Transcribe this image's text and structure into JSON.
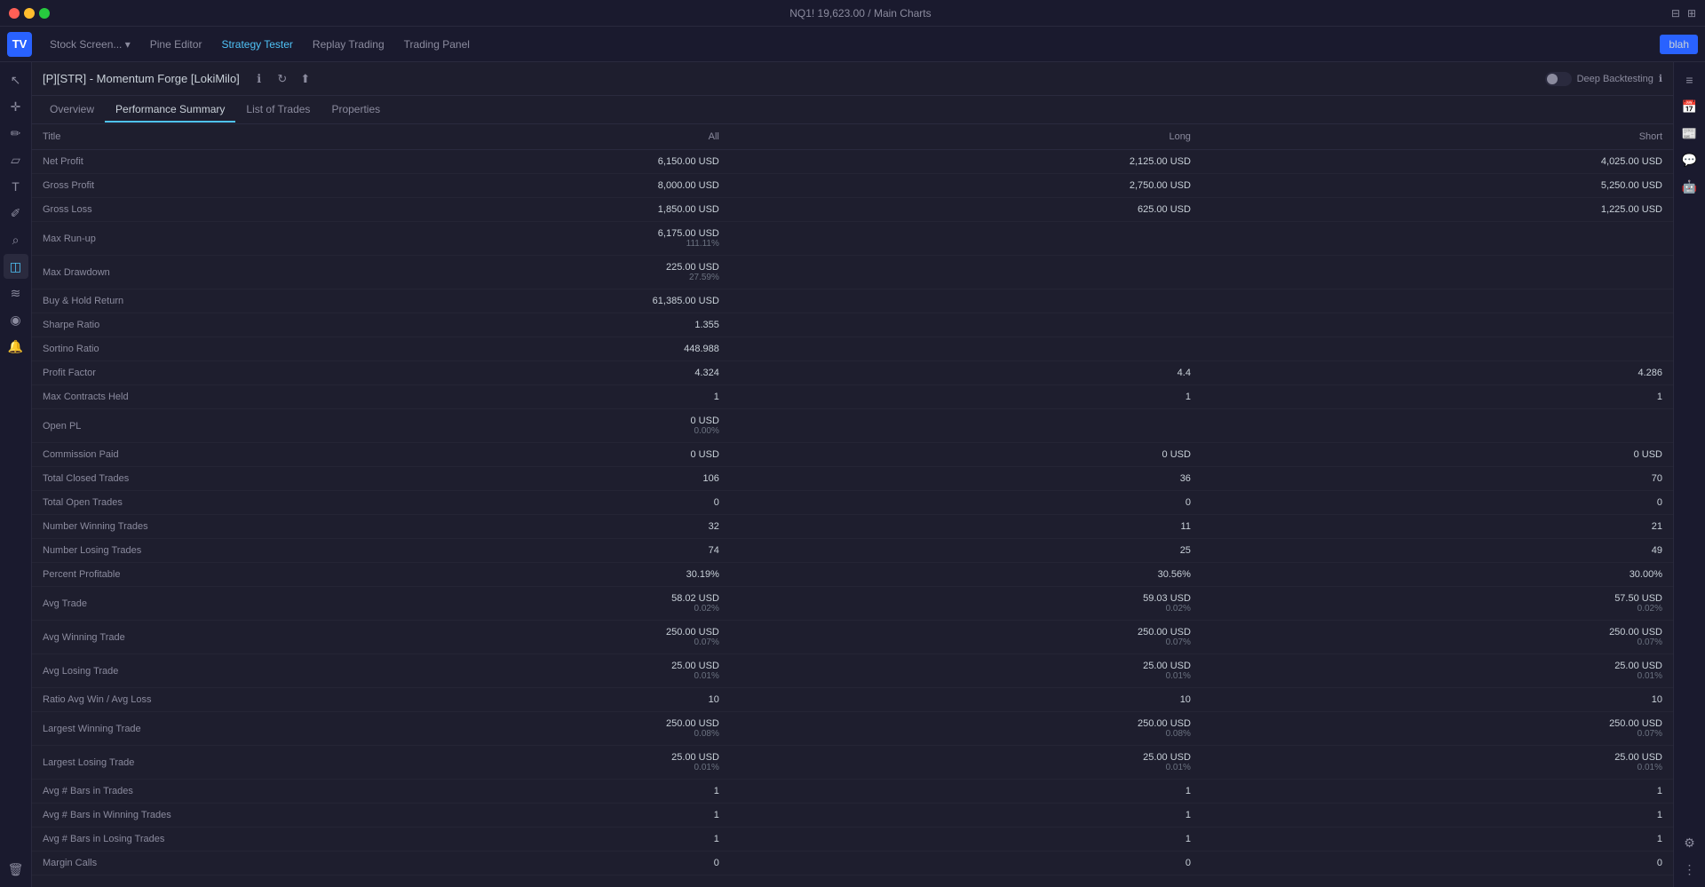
{
  "titlebar": {
    "title": "NQ1! 19,623.00 / Main Charts"
  },
  "topnav": {
    "logo": "TV",
    "items": [
      {
        "label": "Stock Screen...",
        "active": false,
        "dropdown": true
      },
      {
        "label": "Pine Editor",
        "active": false
      },
      {
        "label": "Strategy Tester",
        "active": true
      },
      {
        "label": "Replay Trading",
        "active": false
      },
      {
        "label": "Trading Panel",
        "active": false
      }
    ],
    "user_btn": "blah"
  },
  "left_sidebar_icons": [
    {
      "name": "cursor-icon",
      "symbol": "↖",
      "active": false
    },
    {
      "name": "crosshair-icon",
      "symbol": "+",
      "active": false
    },
    {
      "name": "pencil-icon",
      "symbol": "✏",
      "active": false
    },
    {
      "name": "shapes-icon",
      "symbol": "▱",
      "active": false
    },
    {
      "name": "text-icon",
      "symbol": "T",
      "active": false
    },
    {
      "name": "draw-icon",
      "symbol": "✐",
      "active": false
    },
    {
      "name": "search-icon",
      "symbol": "🔍",
      "active": false
    },
    {
      "name": "chart-icon",
      "symbol": "📊",
      "active": true
    },
    {
      "name": "indicator-icon",
      "symbol": "≋",
      "active": false
    },
    {
      "name": "eye-icon",
      "symbol": "👁",
      "active": false
    },
    {
      "name": "alert-icon",
      "symbol": "🔔",
      "active": false
    },
    {
      "name": "trash-icon",
      "symbol": "🗑",
      "active": false
    }
  ],
  "strategy_tester": {
    "script_name": "[P][STR] - Momentum Forge [LokiMilo]",
    "deep_backtesting_label": "Deep Backtesting"
  },
  "tabs": [
    {
      "label": "Overview",
      "active": false
    },
    {
      "label": "Performance Summary",
      "active": true
    },
    {
      "label": "List of Trades",
      "active": false
    },
    {
      "label": "Properties",
      "active": false
    }
  ],
  "table": {
    "headers": [
      {
        "label": "Title",
        "align": "left"
      },
      {
        "label": "All",
        "align": "right"
      },
      {
        "label": "Long",
        "align": "right"
      },
      {
        "label": "Short",
        "align": "right"
      }
    ],
    "rows": [
      {
        "title": "Net Profit",
        "all": "6,150.00 USD",
        "all2": "",
        "long": "2,125.00 USD",
        "long2": "",
        "short": "4,025.00 USD",
        "short2": ""
      },
      {
        "title": "Gross Profit",
        "all": "8,000.00 USD",
        "all2": "",
        "long": "2,750.00 USD",
        "long2": "",
        "short": "5,250.00 USD",
        "short2": ""
      },
      {
        "title": "Gross Loss",
        "all": "1,850.00 USD",
        "all2": "",
        "long": "625.00 USD",
        "long2": "",
        "short": "1,225.00 USD",
        "short2": ""
      },
      {
        "title": "Max Run-up",
        "all": "6,175.00 USD",
        "all2": "111.11%",
        "long": "",
        "long2": "",
        "short": "",
        "short2": ""
      },
      {
        "title": "Max Drawdown",
        "all": "225.00 USD",
        "all2": "27.59%",
        "long": "",
        "long2": "",
        "short": "",
        "short2": ""
      },
      {
        "title": "Buy & Hold Return",
        "all": "61,385.00 USD",
        "all2": "",
        "long": "",
        "long2": "",
        "short": "",
        "short2": ""
      },
      {
        "title": "Sharpe Ratio",
        "all": "1.355",
        "all2": "",
        "long": "",
        "long2": "",
        "short": "",
        "short2": ""
      },
      {
        "title": "Sortino Ratio",
        "all": "448.988",
        "all2": "",
        "long": "",
        "long2": "",
        "short": "",
        "short2": ""
      },
      {
        "title": "Profit Factor",
        "all": "4.324",
        "all2": "",
        "long": "4.4",
        "long2": "",
        "short": "4.286",
        "short2": ""
      },
      {
        "title": "Max Contracts Held",
        "all": "1",
        "all2": "",
        "long": "1",
        "long2": "",
        "short": "1",
        "short2": ""
      },
      {
        "title": "Open PL",
        "all": "0 USD",
        "all2": "0.00%",
        "long": "",
        "long2": "",
        "short": "",
        "short2": ""
      },
      {
        "title": "Commission Paid",
        "all": "0 USD",
        "all2": "",
        "long": "0 USD",
        "long2": "",
        "short": "0 USD",
        "short2": ""
      },
      {
        "title": "Total Closed Trades",
        "all": "106",
        "all2": "",
        "long": "36",
        "long2": "",
        "short": "70",
        "short2": ""
      },
      {
        "title": "Total Open Trades",
        "all": "0",
        "all2": "",
        "long": "0",
        "long2": "",
        "short": "0",
        "short2": ""
      },
      {
        "title": "Number Winning Trades",
        "all": "32",
        "all2": "",
        "long": "11",
        "long2": "",
        "short": "21",
        "short2": ""
      },
      {
        "title": "Number Losing Trades",
        "all": "74",
        "all2": "",
        "long": "25",
        "long2": "",
        "short": "49",
        "short2": ""
      },
      {
        "title": "Percent Profitable",
        "all": "30.19%",
        "all2": "",
        "long": "30.56%",
        "long2": "",
        "short": "30.00%",
        "short2": ""
      },
      {
        "title": "Avg Trade",
        "all": "58.02 USD",
        "all2": "0.02%",
        "long": "59.03 USD",
        "long2": "0.02%",
        "short": "57.50 USD",
        "short2": "0.02%"
      },
      {
        "title": "Avg Winning Trade",
        "all": "250.00 USD",
        "all2": "0.07%",
        "long": "250.00 USD",
        "long2": "0.07%",
        "short": "250.00 USD",
        "short2": "0.07%"
      },
      {
        "title": "Avg Losing Trade",
        "all": "25.00 USD",
        "all2": "0.01%",
        "long": "25.00 USD",
        "long2": "0.01%",
        "short": "25.00 USD",
        "short2": "0.01%"
      },
      {
        "title": "Ratio Avg Win / Avg Loss",
        "all": "10",
        "all2": "",
        "long": "10",
        "long2": "",
        "short": "10",
        "short2": ""
      },
      {
        "title": "Largest Winning Trade",
        "all": "250.00 USD",
        "all2": "0.08%",
        "long": "250.00 USD",
        "long2": "0.08%",
        "short": "250.00 USD",
        "short2": "0.07%"
      },
      {
        "title": "Largest Losing Trade",
        "all": "25.00 USD",
        "all2": "0.01%",
        "long": "25.00 USD",
        "long2": "0.01%",
        "short": "25.00 USD",
        "short2": "0.01%"
      },
      {
        "title": "Avg # Bars in Trades",
        "all": "1",
        "all2": "",
        "long": "1",
        "long2": "",
        "short": "1",
        "short2": ""
      },
      {
        "title": "Avg # Bars in Winning Trades",
        "all": "1",
        "all2": "",
        "long": "1",
        "long2": "",
        "short": "1",
        "short2": ""
      },
      {
        "title": "Avg # Bars in Losing Trades",
        "all": "1",
        "all2": "",
        "long": "1",
        "long2": "",
        "short": "1",
        "short2": ""
      },
      {
        "title": "Margin Calls",
        "all": "0",
        "all2": "",
        "long": "0",
        "long2": "",
        "short": "0",
        "short2": ""
      }
    ]
  },
  "right_sidebar_icons": [
    {
      "name": "watchlist-icon",
      "symbol": "≡"
    },
    {
      "name": "calendar-icon",
      "symbol": "📅"
    },
    {
      "name": "news-icon",
      "symbol": "📰"
    },
    {
      "name": "chat-icon",
      "symbol": "💬"
    },
    {
      "name": "bot-icon",
      "symbol": "🤖"
    },
    {
      "name": "settings2-icon",
      "symbol": "⚙"
    },
    {
      "name": "dots-icon",
      "symbol": "⋮"
    }
  ]
}
